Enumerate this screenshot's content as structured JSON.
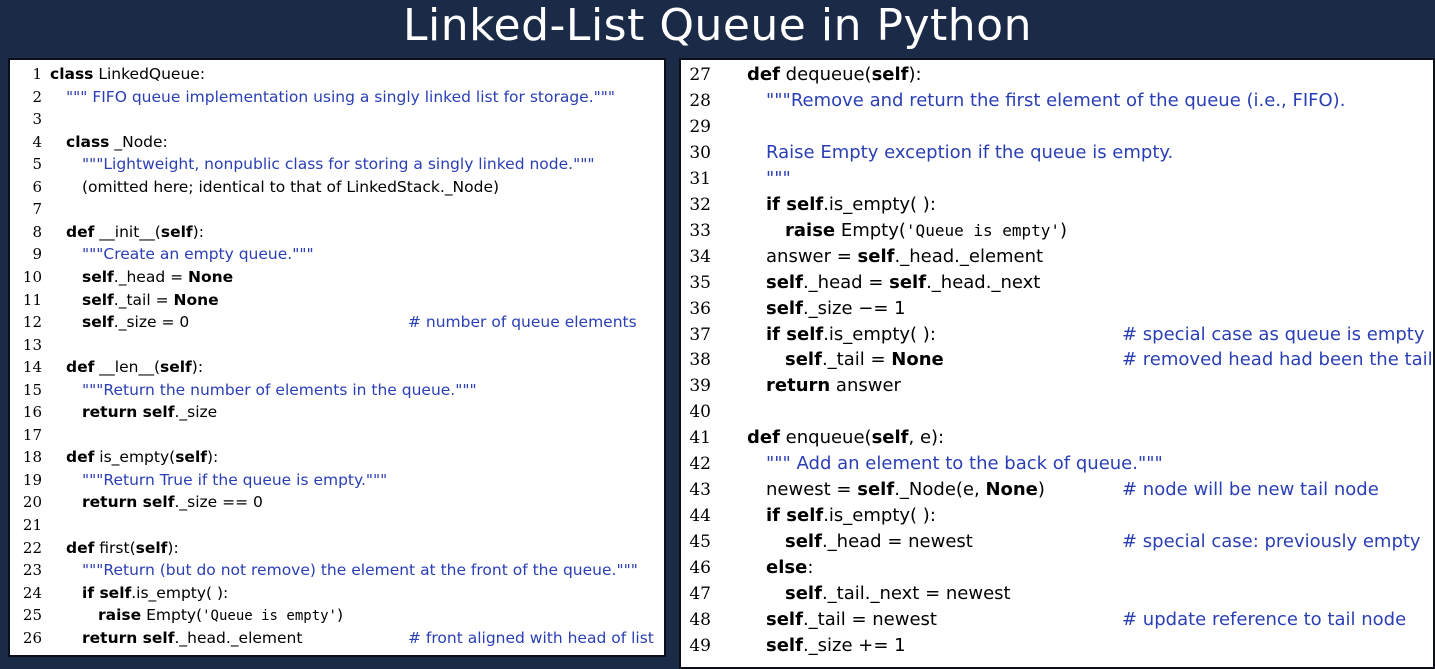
{
  "title": "Linked-List Queue in Python",
  "colors": {
    "background": "#1b2a47",
    "panel": "#ffffff",
    "docstring": "#2a3fb5",
    "comment": "#2a3fb5",
    "text": "#000000"
  },
  "left_panel": {
    "lines": [
      {
        "num": "1",
        "indent": 0,
        "segments": [
          {
            "t": "class",
            "s": "kw"
          },
          {
            "t": " LinkedQueue:"
          }
        ],
        "comment": ""
      },
      {
        "num": "2",
        "indent": 1,
        "segments": [
          {
            "t": "\"\"\" FIFO queue implementation using a singly linked list for storage.\"\"\"",
            "s": "doc"
          }
        ],
        "comment": ""
      },
      {
        "num": "3",
        "indent": 0,
        "segments": [],
        "comment": ""
      },
      {
        "num": "4",
        "indent": 1,
        "segments": [
          {
            "t": "class",
            "s": "kw"
          },
          {
            "t": " _Node:"
          }
        ],
        "comment": ""
      },
      {
        "num": "5",
        "indent": 2,
        "segments": [
          {
            "t": "\"\"\"Lightweight, nonpublic class for storing a singly linked node.\"\"\"",
            "s": "doc"
          }
        ],
        "comment": ""
      },
      {
        "num": "6",
        "indent": 2,
        "segments": [
          {
            "t": "(omitted here; identical to that of LinkedStack._Node)"
          }
        ],
        "comment": ""
      },
      {
        "num": "7",
        "indent": 0,
        "segments": [],
        "comment": ""
      },
      {
        "num": "8",
        "indent": 1,
        "segments": [
          {
            "t": "def",
            "s": "kw"
          },
          {
            "t": " __init__("
          },
          {
            "t": "self",
            "s": "kw"
          },
          {
            "t": "):"
          }
        ],
        "comment": ""
      },
      {
        "num": "9",
        "indent": 2,
        "segments": [
          {
            "t": "\"\"\"Create an empty queue.\"\"\"",
            "s": "doc"
          }
        ],
        "comment": ""
      },
      {
        "num": "10",
        "indent": 2,
        "segments": [
          {
            "t": "self",
            "s": "kw"
          },
          {
            "t": "._head = "
          },
          {
            "t": "None",
            "s": "kw"
          }
        ],
        "comment": ""
      },
      {
        "num": "11",
        "indent": 2,
        "segments": [
          {
            "t": "self",
            "s": "kw"
          },
          {
            "t": "._tail = "
          },
          {
            "t": "None",
            "s": "kw"
          }
        ],
        "comment": ""
      },
      {
        "num": "12",
        "indent": 2,
        "segments": [
          {
            "t": "self",
            "s": "kw"
          },
          {
            "t": "._size = 0"
          }
        ],
        "comment": "# number of queue elements"
      },
      {
        "num": "13",
        "indent": 0,
        "segments": [],
        "comment": ""
      },
      {
        "num": "14",
        "indent": 1,
        "segments": [
          {
            "t": "def",
            "s": "kw"
          },
          {
            "t": " __len__("
          },
          {
            "t": "self",
            "s": "kw"
          },
          {
            "t": "):"
          }
        ],
        "comment": ""
      },
      {
        "num": "15",
        "indent": 2,
        "segments": [
          {
            "t": "\"\"\"Return the number of elements in the queue.\"\"\"",
            "s": "doc"
          }
        ],
        "comment": ""
      },
      {
        "num": "16",
        "indent": 2,
        "segments": [
          {
            "t": "return self",
            "s": "kw"
          },
          {
            "t": "._size"
          }
        ],
        "comment": ""
      },
      {
        "num": "17",
        "indent": 0,
        "segments": [],
        "comment": ""
      },
      {
        "num": "18",
        "indent": 1,
        "segments": [
          {
            "t": "def",
            "s": "kw"
          },
          {
            "t": " is_empty("
          },
          {
            "t": "self",
            "s": "kw"
          },
          {
            "t": "):"
          }
        ],
        "comment": ""
      },
      {
        "num": "19",
        "indent": 2,
        "segments": [
          {
            "t": "\"\"\"Return True if the queue is empty.\"\"\"",
            "s": "doc"
          }
        ],
        "comment": ""
      },
      {
        "num": "20",
        "indent": 2,
        "segments": [
          {
            "t": "return self",
            "s": "kw"
          },
          {
            "t": "._size == 0"
          }
        ],
        "comment": ""
      },
      {
        "num": "21",
        "indent": 0,
        "segments": [],
        "comment": ""
      },
      {
        "num": "22",
        "indent": 1,
        "segments": [
          {
            "t": "def",
            "s": "kw"
          },
          {
            "t": " first("
          },
          {
            "t": "self",
            "s": "kw"
          },
          {
            "t": "):"
          }
        ],
        "comment": ""
      },
      {
        "num": "23",
        "indent": 2,
        "segments": [
          {
            "t": "\"\"\"Return (but do not remove) the element at the front of the queue.\"\"\"",
            "s": "doc"
          }
        ],
        "comment": ""
      },
      {
        "num": "24",
        "indent": 2,
        "segments": [
          {
            "t": "if self",
            "s": "kw"
          },
          {
            "t": ".is_empty( ):"
          }
        ],
        "comment": ""
      },
      {
        "num": "25",
        "indent": 3,
        "segments": [
          {
            "t": "raise",
            "s": "kw"
          },
          {
            "t": " Empty("
          },
          {
            "t": "'Queue is empty'",
            "s": "tt"
          },
          {
            "t": ")"
          }
        ],
        "comment": ""
      },
      {
        "num": "26",
        "indent": 2,
        "segments": [
          {
            "t": "return self",
            "s": "kw"
          },
          {
            "t": "._head._element"
          }
        ],
        "comment": "# front aligned with head of list"
      }
    ]
  },
  "right_panel": {
    "lines": [
      {
        "num": "27",
        "indent": 1,
        "segments": [
          {
            "t": "def",
            "s": "kw"
          },
          {
            "t": " dequeue("
          },
          {
            "t": "self",
            "s": "kw"
          },
          {
            "t": "):"
          }
        ],
        "comment": ""
      },
      {
        "num": "28",
        "indent": 2,
        "segments": [
          {
            "t": "\"\"\"Remove and return the first element of the queue (i.e., FIFO).",
            "s": "doc"
          }
        ],
        "comment": ""
      },
      {
        "num": "29",
        "indent": 0,
        "segments": [],
        "comment": ""
      },
      {
        "num": "30",
        "indent": 2,
        "segments": [
          {
            "t": "Raise Empty exception if the queue is empty.",
            "s": "doc"
          }
        ],
        "comment": ""
      },
      {
        "num": "31",
        "indent": 2,
        "segments": [
          {
            "t": "\"\"\"",
            "s": "doc"
          }
        ],
        "comment": ""
      },
      {
        "num": "32",
        "indent": 2,
        "segments": [
          {
            "t": "if self",
            "s": "kw"
          },
          {
            "t": ".is_empty( ):"
          }
        ],
        "comment": ""
      },
      {
        "num": "33",
        "indent": 3,
        "segments": [
          {
            "t": "raise",
            "s": "kw"
          },
          {
            "t": " Empty("
          },
          {
            "t": "'Queue is empty'",
            "s": "tt"
          },
          {
            "t": ")"
          }
        ],
        "comment": ""
      },
      {
        "num": "34",
        "indent": 2,
        "segments": [
          {
            "t": "answer = "
          },
          {
            "t": "self",
            "s": "kw"
          },
          {
            "t": "._head._element"
          }
        ],
        "comment": ""
      },
      {
        "num": "35",
        "indent": 2,
        "segments": [
          {
            "t": "self",
            "s": "kw"
          },
          {
            "t": "._head = "
          },
          {
            "t": "self",
            "s": "kw"
          },
          {
            "t": "._head._next"
          }
        ],
        "comment": ""
      },
      {
        "num": "36",
        "indent": 2,
        "segments": [
          {
            "t": "self",
            "s": "kw"
          },
          {
            "t": "._size −= 1"
          }
        ],
        "comment": ""
      },
      {
        "num": "37",
        "indent": 2,
        "segments": [
          {
            "t": "if self",
            "s": "kw"
          },
          {
            "t": ".is_empty( ):"
          }
        ],
        "comment": "# special case as queue is empty"
      },
      {
        "num": "38",
        "indent": 3,
        "segments": [
          {
            "t": "self",
            "s": "kw"
          },
          {
            "t": "._tail = "
          },
          {
            "t": "None",
            "s": "kw"
          }
        ],
        "comment": "# removed head had been the tail"
      },
      {
        "num": "39",
        "indent": 2,
        "segments": [
          {
            "t": "return",
            "s": "kw"
          },
          {
            "t": " answer"
          }
        ],
        "comment": ""
      },
      {
        "num": "40",
        "indent": 0,
        "segments": [],
        "comment": ""
      },
      {
        "num": "41",
        "indent": 1,
        "segments": [
          {
            "t": "def",
            "s": "kw"
          },
          {
            "t": " enqueue("
          },
          {
            "t": "self",
            "s": "kw"
          },
          {
            "t": ", e):"
          }
        ],
        "comment": ""
      },
      {
        "num": "42",
        "indent": 2,
        "segments": [
          {
            "t": "\"\"\" Add an element to the back of queue.\"\"\"",
            "s": "doc"
          }
        ],
        "comment": ""
      },
      {
        "num": "43",
        "indent": 2,
        "segments": [
          {
            "t": "newest = "
          },
          {
            "t": "self",
            "s": "kw"
          },
          {
            "t": "._Node(e, "
          },
          {
            "t": "None",
            "s": "kw"
          },
          {
            "t": ")"
          }
        ],
        "comment": "# node will be new tail node"
      },
      {
        "num": "44",
        "indent": 2,
        "segments": [
          {
            "t": "if self",
            "s": "kw"
          },
          {
            "t": ".is_empty( ):"
          }
        ],
        "comment": ""
      },
      {
        "num": "45",
        "indent": 3,
        "segments": [
          {
            "t": "self",
            "s": "kw"
          },
          {
            "t": "._head = newest"
          }
        ],
        "comment": "# special case: previously empty"
      },
      {
        "num": "46",
        "indent": 2,
        "segments": [
          {
            "t": "else",
            "s": "kw"
          },
          {
            "t": ":"
          }
        ],
        "comment": ""
      },
      {
        "num": "47",
        "indent": 3,
        "segments": [
          {
            "t": "self",
            "s": "kw"
          },
          {
            "t": "._tail._next = newest"
          }
        ],
        "comment": ""
      },
      {
        "num": "48",
        "indent": 2,
        "segments": [
          {
            "t": "self",
            "s": "kw"
          },
          {
            "t": "._tail = newest"
          }
        ],
        "comment": "# update reference to tail node"
      },
      {
        "num": "49",
        "indent": 2,
        "segments": [
          {
            "t": "self",
            "s": "kw"
          },
          {
            "t": "._size += 1"
          }
        ],
        "comment": ""
      }
    ]
  }
}
